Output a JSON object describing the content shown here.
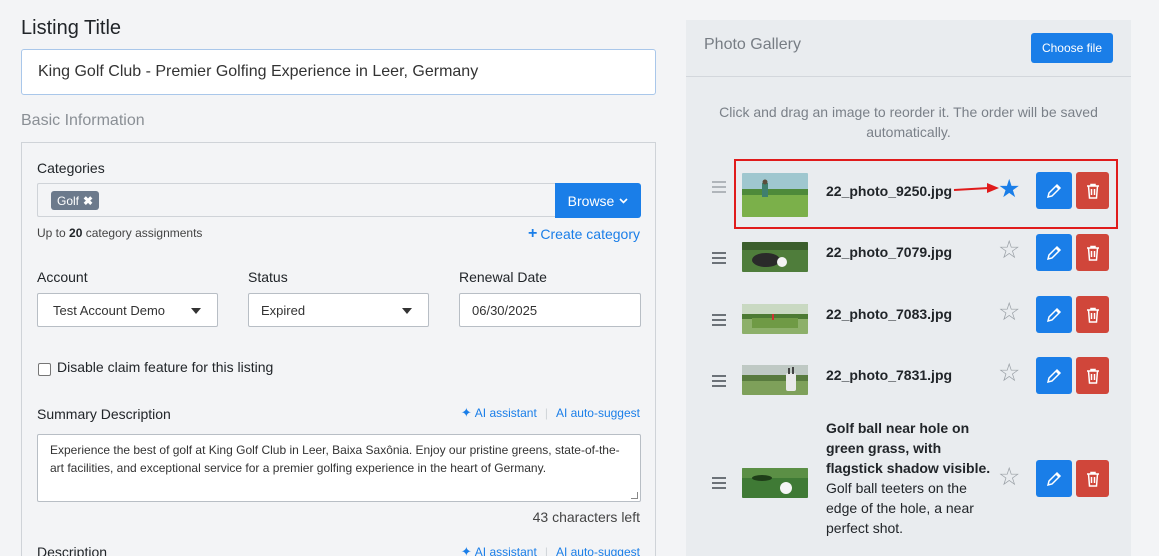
{
  "listing": {
    "title_label": "Listing Title",
    "title_value": "King Golf Club - Premier Golfing Experience in Leer, Germany"
  },
  "basic": {
    "heading": "Basic Information",
    "categories_label": "Categories",
    "category_tag": "Golf",
    "browse_label": "Browse",
    "hint_prefix": "Up to ",
    "hint_count": "20",
    "hint_suffix": " category assignments",
    "create_category": "Create category",
    "account_label": "Account",
    "account_value": "Test Account Demo",
    "status_label": "Status",
    "status_value": "Expired",
    "renewal_label": "Renewal Date",
    "renewal_value": "06/30/2025",
    "disable_claim": "Disable claim feature for this listing",
    "summary_label": "Summary Description",
    "ai_assistant": "AI assistant",
    "ai_suggest": "AI auto-suggest",
    "summary_value": "Experience the best of golf at King Golf Club in Leer, Baixa Saxônia. Enjoy our pristine greens, state-of-the-art facilities, and exceptional service for a premier golfing experience in the heart of Germany.",
    "chars_left": "43 characters left",
    "description_label": "Description"
  },
  "gallery": {
    "title": "Photo Gallery",
    "choose_file": "Choose file",
    "hint": "Click and drag an image to reorder it. The order will be saved automatically.",
    "photos": [
      {
        "name": "22_photo_9250.jpg",
        "featured": true
      },
      {
        "name": "22_photo_7079.jpg",
        "featured": false
      },
      {
        "name": "22_photo_7083.jpg",
        "featured": false
      },
      {
        "name": "22_photo_7831.jpg",
        "featured": false
      }
    ],
    "caption_title": "Golf ball near hole on green grass, with flagstick shadow visible.",
    "caption_body": "Golf ball teeters on the edge of the hole, a near perfect shot."
  },
  "colors": {
    "primary": "#1a7ee8",
    "danger": "#d0463a",
    "highlight": "#e01b1b"
  }
}
